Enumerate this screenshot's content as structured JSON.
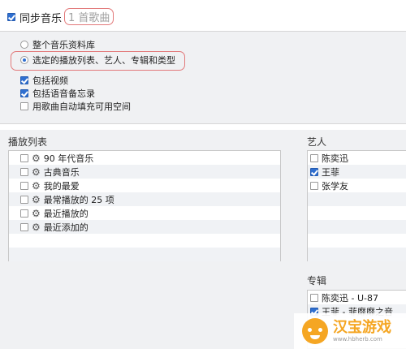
{
  "sync": {
    "label": "同步音乐",
    "count_badge": "1 首歌曲",
    "options": {
      "entire_library": "整个音乐资料库",
      "selected": "选定的播放列表、艺人、专辑和类型",
      "include_videos": "包括视频",
      "include_voice_memos": "包括语音备忘录",
      "autofill": "用歌曲自动填充可用空间"
    }
  },
  "playlists": {
    "title": "播放列表",
    "items": [
      "90 年代音乐",
      "古典音乐",
      "我的最爱",
      "最常播放的 25 项",
      "最近播放的",
      "最近添加的"
    ]
  },
  "artists": {
    "title": "艺人",
    "items": [
      "陈奕迅",
      "王菲",
      "张学友"
    ]
  },
  "albums": {
    "title": "专辑",
    "items": [
      "陈奕迅 - U-87",
      "王菲 - 菲靡靡之音"
    ]
  },
  "watermark": {
    "text": "汉宝游戏",
    "url": "www.hbherb.com"
  },
  "colors": {
    "accent": "#2f6fd0",
    "highlight_outline": "#e2797a",
    "panel_bg": "#f0f1f3"
  }
}
